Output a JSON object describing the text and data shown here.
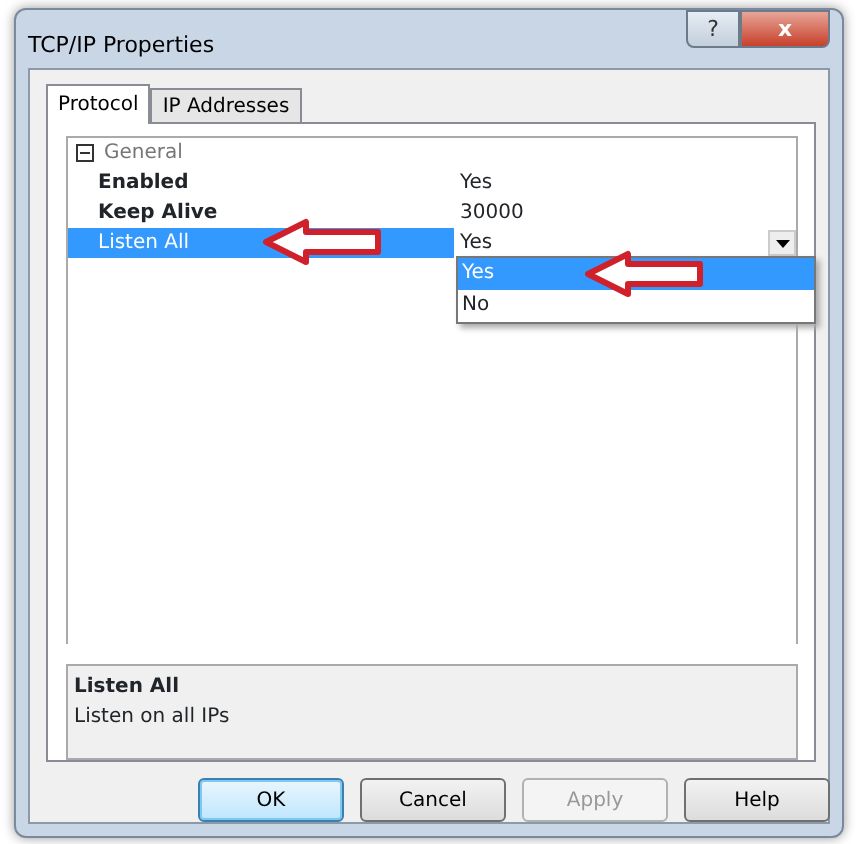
{
  "window": {
    "title": "TCP/IP Properties"
  },
  "title_buttons": [
    {
      "kind": "help",
      "label": "?"
    },
    {
      "kind": "close",
      "label": "x"
    }
  ],
  "tabs": [
    {
      "label": "Protocol",
      "selected": true
    },
    {
      "label": "IP Addresses",
      "selected": false
    }
  ],
  "property_grid": {
    "category": {
      "label": "General",
      "expanded": true
    },
    "properties": [
      {
        "name": "Enabled",
        "value": "Yes",
        "selected": false
      },
      {
        "name": "Keep Alive",
        "value": "30000",
        "selected": false
      },
      {
        "name": "Listen All",
        "value": "Yes",
        "selected": true
      }
    ],
    "dropdown": {
      "options": [
        {
          "label": "Yes",
          "selected": true
        },
        {
          "label": "No",
          "selected": false
        }
      ]
    }
  },
  "description": {
    "title": "Listen All",
    "text": "Listen on all IPs"
  },
  "buttons": [
    {
      "label": "OK",
      "default": true,
      "disabled": false
    },
    {
      "label": "Cancel",
      "default": false,
      "disabled": false
    },
    {
      "label": "Apply",
      "default": false,
      "disabled": true
    },
    {
      "label": "Help",
      "default": false,
      "disabled": false
    }
  ]
}
